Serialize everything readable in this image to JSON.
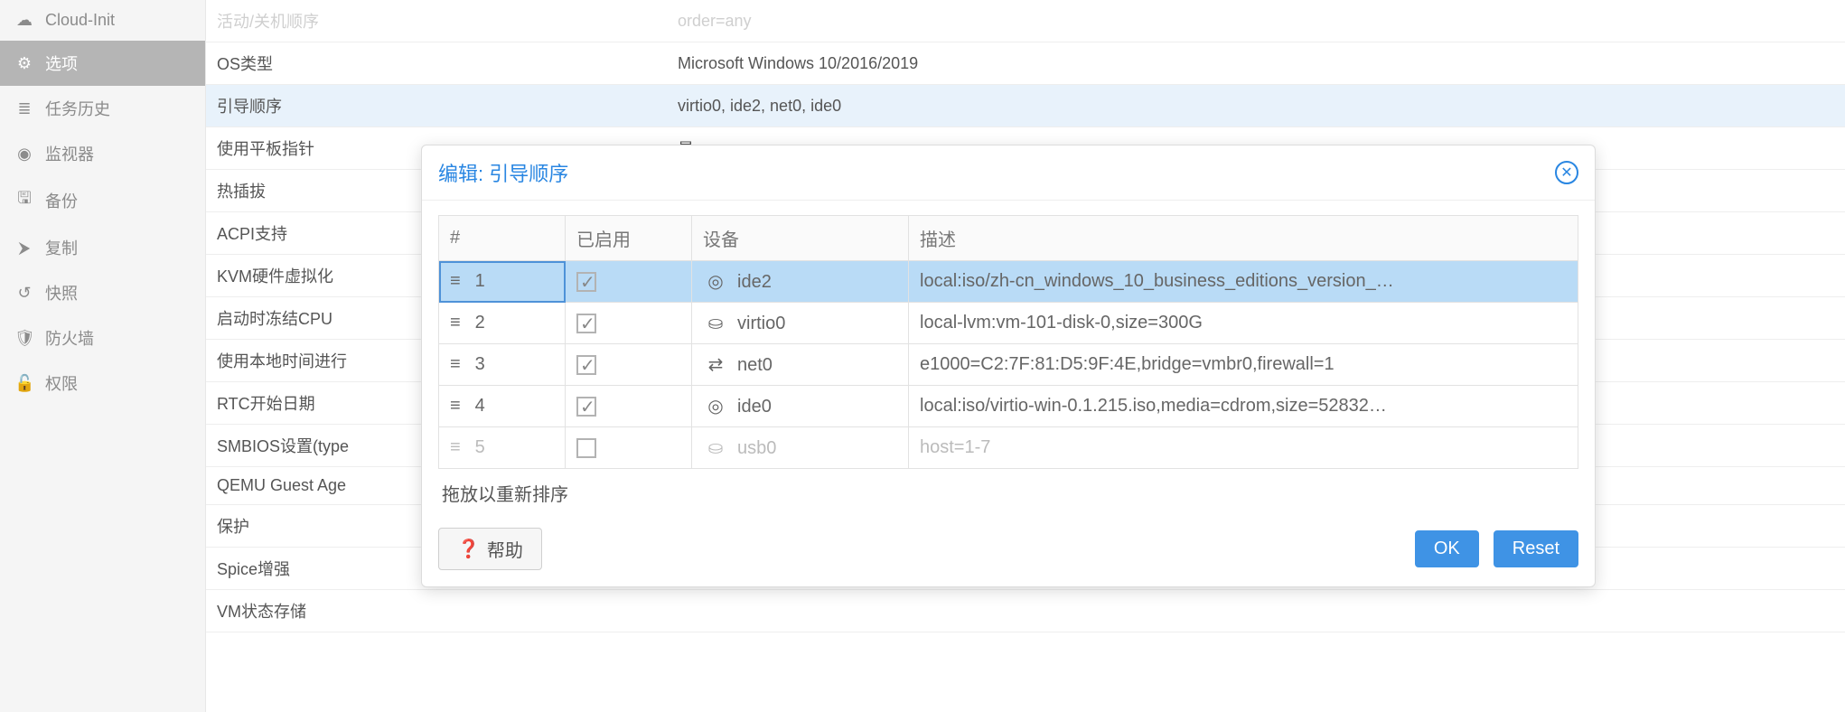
{
  "sidebar": {
    "items": [
      {
        "label": "Cloud-Init",
        "icon": "☁"
      },
      {
        "label": "选项",
        "icon": "⚙",
        "active": true
      },
      {
        "label": "任务历史",
        "icon": "≣"
      },
      {
        "label": "监视器",
        "icon": "◉"
      },
      {
        "label": "备份",
        "icon": "🖫"
      },
      {
        "label": "复制",
        "icon": "⮞"
      },
      {
        "label": "快照",
        "icon": "↺"
      },
      {
        "label": "防火墙",
        "icon": "🛡"
      },
      {
        "label": "权限",
        "icon": "🔓"
      }
    ]
  },
  "props": [
    {
      "label": "活动/关机顺序",
      "value": "order=any",
      "fade": true
    },
    {
      "label": "OS类型",
      "value": "Microsoft Windows 10/2016/2019"
    },
    {
      "label": "引导顺序",
      "value": "virtio0, ide2, net0, ide0",
      "sel": true
    },
    {
      "label": "使用平板指针",
      "value": "是"
    },
    {
      "label": "热插拔",
      "value": ""
    },
    {
      "label": "ACPI支持",
      "value": ""
    },
    {
      "label": "KVM硬件虚拟化",
      "value": ""
    },
    {
      "label": "启动时冻结CPU",
      "value": ""
    },
    {
      "label": "使用本地时间进行",
      "value": ""
    },
    {
      "label": "RTC开始日期",
      "value": ""
    },
    {
      "label": "SMBIOS设置(type",
      "value": ""
    },
    {
      "label": "QEMU Guest Age",
      "value": ""
    },
    {
      "label": "保护",
      "value": ""
    },
    {
      "label": "Spice增强",
      "value": ""
    },
    {
      "label": "VM状态存储",
      "value": ""
    }
  ],
  "dialog": {
    "title": "编辑: 引导顺序",
    "columns": {
      "num": "#",
      "enabled": "已启用",
      "device": "设备",
      "desc": "描述"
    },
    "rows": [
      {
        "n": "1",
        "on": true,
        "icon": "◎",
        "device": "ide2",
        "desc": "local:iso/zh-cn_windows_10_business_editions_version_…",
        "selected": true
      },
      {
        "n": "2",
        "on": true,
        "icon": "⛀",
        "device": "virtio0",
        "desc": "local-lvm:vm-101-disk-0,size=300G"
      },
      {
        "n": "3",
        "on": true,
        "icon": "⇄",
        "device": "net0",
        "desc": "e1000=C2:7F:81:D5:9F:4E,bridge=vmbr0,firewall=1"
      },
      {
        "n": "4",
        "on": true,
        "icon": "◎",
        "device": "ide0",
        "desc": "local:iso/virtio-win-0.1.215.iso,media=cdrom,size=52832…"
      },
      {
        "n": "5",
        "on": false,
        "icon": "⛀",
        "device": "usb0",
        "desc": "host=1-7",
        "disabled": true
      }
    ],
    "hint": "拖放以重新排序",
    "buttons": {
      "help": "帮助",
      "ok": "OK",
      "reset": "Reset"
    }
  }
}
